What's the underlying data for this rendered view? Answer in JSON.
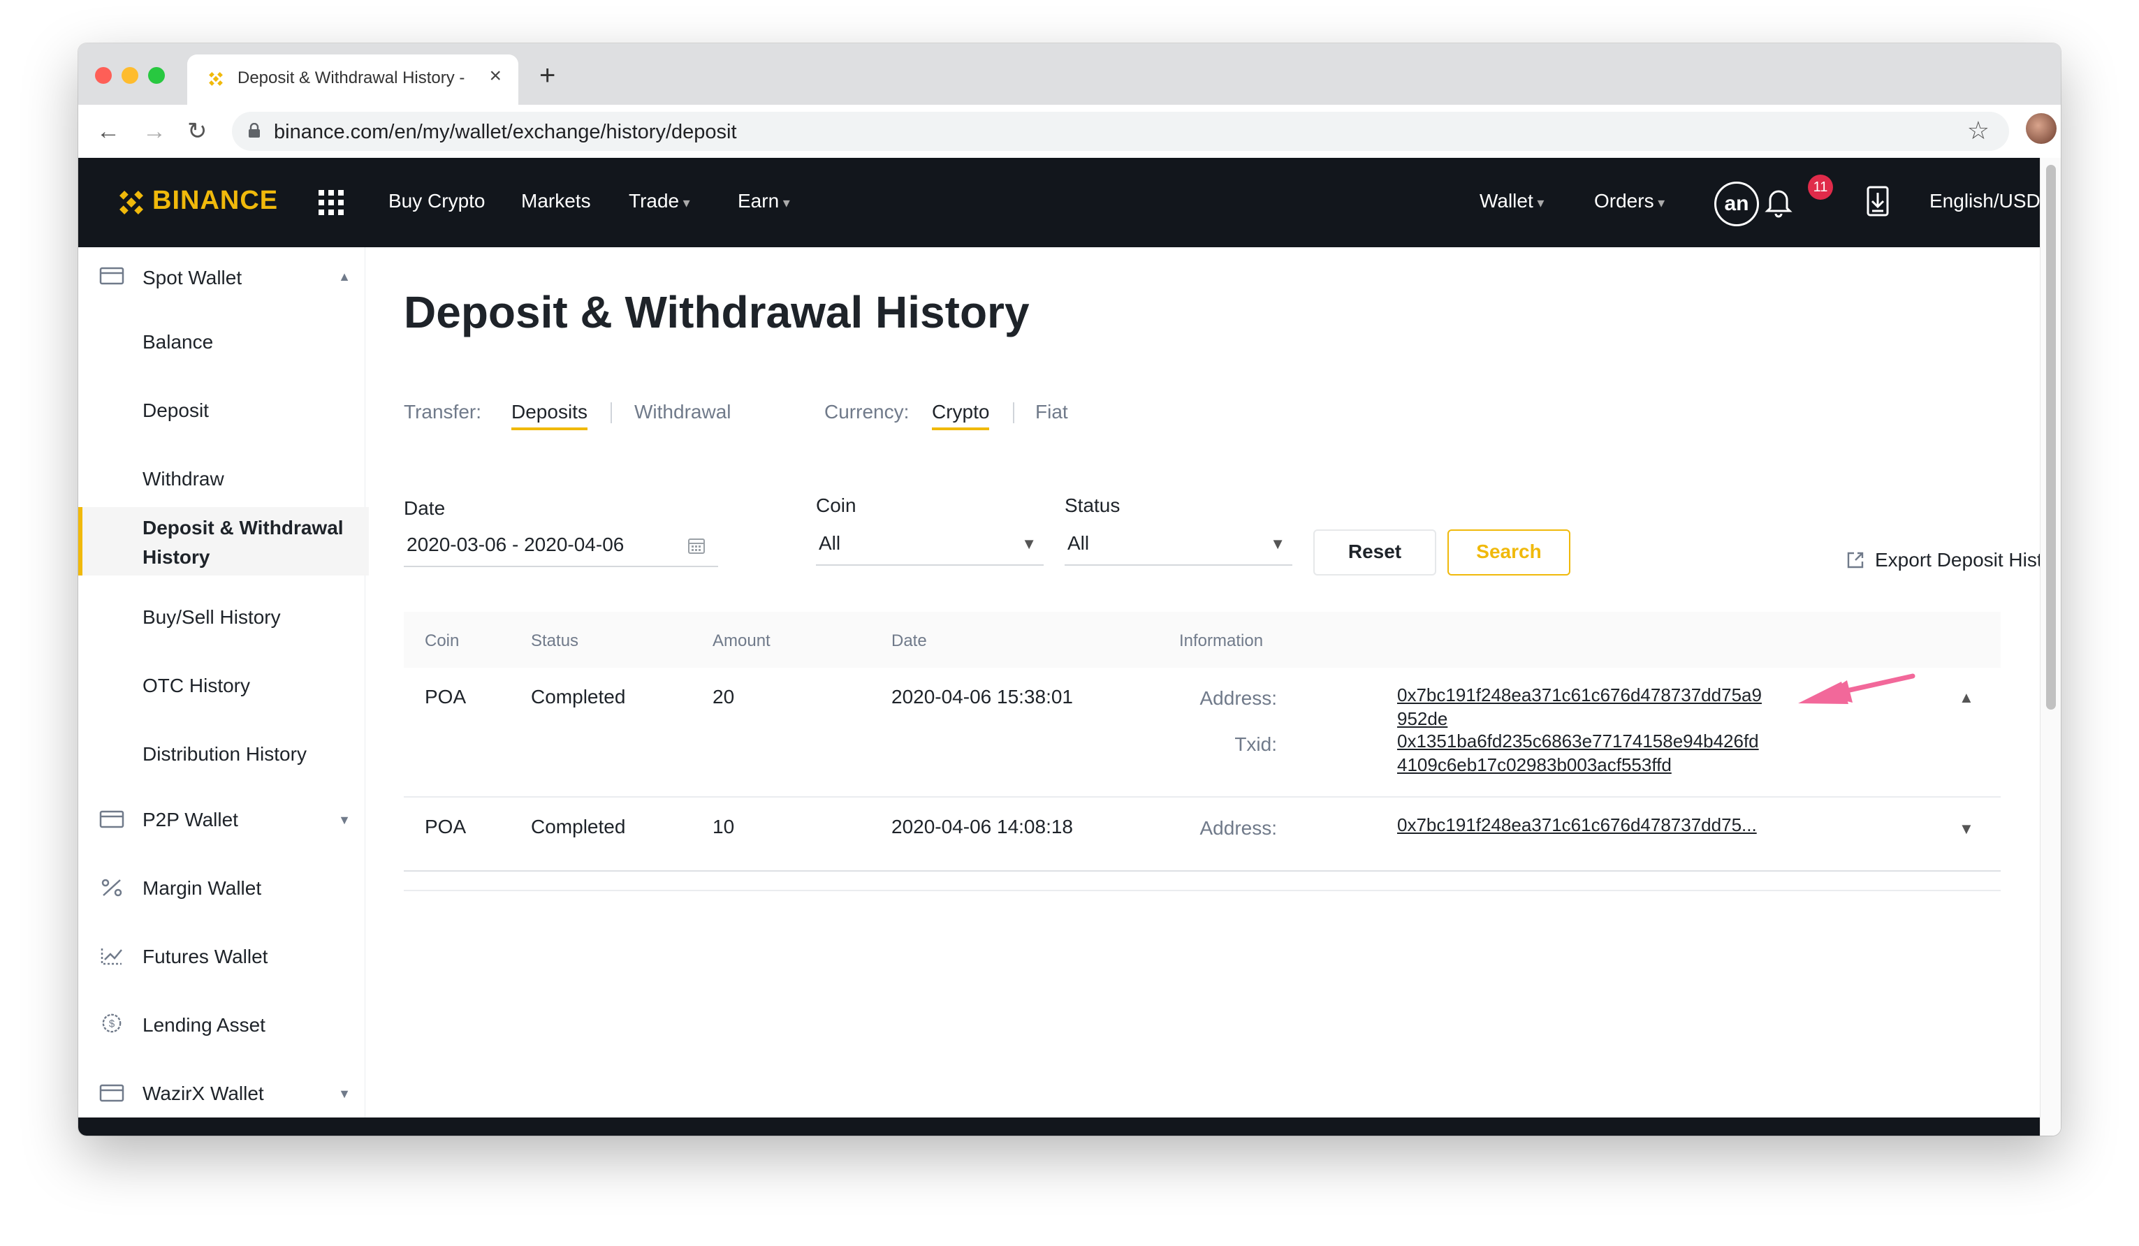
{
  "browser": {
    "tab_title": "Deposit & Withdrawal History -",
    "url": "binance.com/en/my/wallet/exchange/history/deposit"
  },
  "header": {
    "logo": "BINANCE",
    "nav": [
      "Buy Crypto",
      "Markets",
      "Trade",
      "Earn"
    ],
    "right": {
      "wallet": "Wallet",
      "orders": "Orders",
      "avatar": "an",
      "notifications": "11",
      "locale": "English/USD"
    }
  },
  "sidebar": {
    "items": [
      {
        "label": "Spot Wallet"
      },
      {
        "label": "Balance"
      },
      {
        "label": "Deposit"
      },
      {
        "label": "Withdraw"
      },
      {
        "label": "Deposit & Withdrawal",
        "label2": "History"
      },
      {
        "label": "Buy/Sell History"
      },
      {
        "label": "OTC History"
      },
      {
        "label": "Distribution History"
      },
      {
        "label": "P2P Wallet"
      },
      {
        "label": "Margin Wallet"
      },
      {
        "label": "Futures Wallet"
      },
      {
        "label": "Lending Asset"
      },
      {
        "label": "WazirX Wallet"
      }
    ]
  },
  "page": {
    "title": "Deposit & Withdrawal History",
    "transfer": {
      "label": "Transfer:",
      "deposits": "Deposits",
      "withdrawal": "Withdrawal"
    },
    "currency": {
      "label": "Currency:",
      "crypto": "Crypto",
      "fiat": "Fiat"
    },
    "filters": {
      "date_label": "Date",
      "date_value": "2020-03-06 - 2020-04-06",
      "coin_label": "Coin",
      "coin_value": "All",
      "status_label": "Status",
      "status_value": "All",
      "reset": "Reset",
      "search": "Search"
    },
    "export": "Export Deposit History"
  },
  "table": {
    "columns": [
      "Coin",
      "Status",
      "Amount",
      "Date",
      "Information"
    ],
    "rows": [
      {
        "coin": "POA",
        "status": "Completed",
        "amount": "20",
        "date": "2020-04-06 15:38:01",
        "address_label": "Address:",
        "address_1": "0x7bc191f248ea371c61c676d478737dd75a9",
        "address_2": "952de",
        "txid_label": "Txid:",
        "txid_1": "0x1351ba6fd235c6863e77174158e94b426fd",
        "txid_2": "4109c6eb17c02983b003acf553ffd"
      },
      {
        "coin": "POA",
        "status": "Completed",
        "amount": "10",
        "date": "2020-04-06 14:08:18",
        "address_label": "Address:",
        "address_1": "0x7bc191f248ea371c61c676d478737dd75..."
      }
    ]
  },
  "colors": {
    "brand": "#f0b90b",
    "header_bg": "#12161c",
    "annotation_arrow": "#f2689a",
    "badge": "#e02b4a"
  },
  "icons": [
    "lock-icon",
    "star-icon",
    "apps-grid-icon",
    "bell-icon",
    "download-icon",
    "wallet-icon",
    "percent-icon",
    "futures-icon",
    "dollar-circle-icon",
    "calendar-icon",
    "export-icon"
  ]
}
